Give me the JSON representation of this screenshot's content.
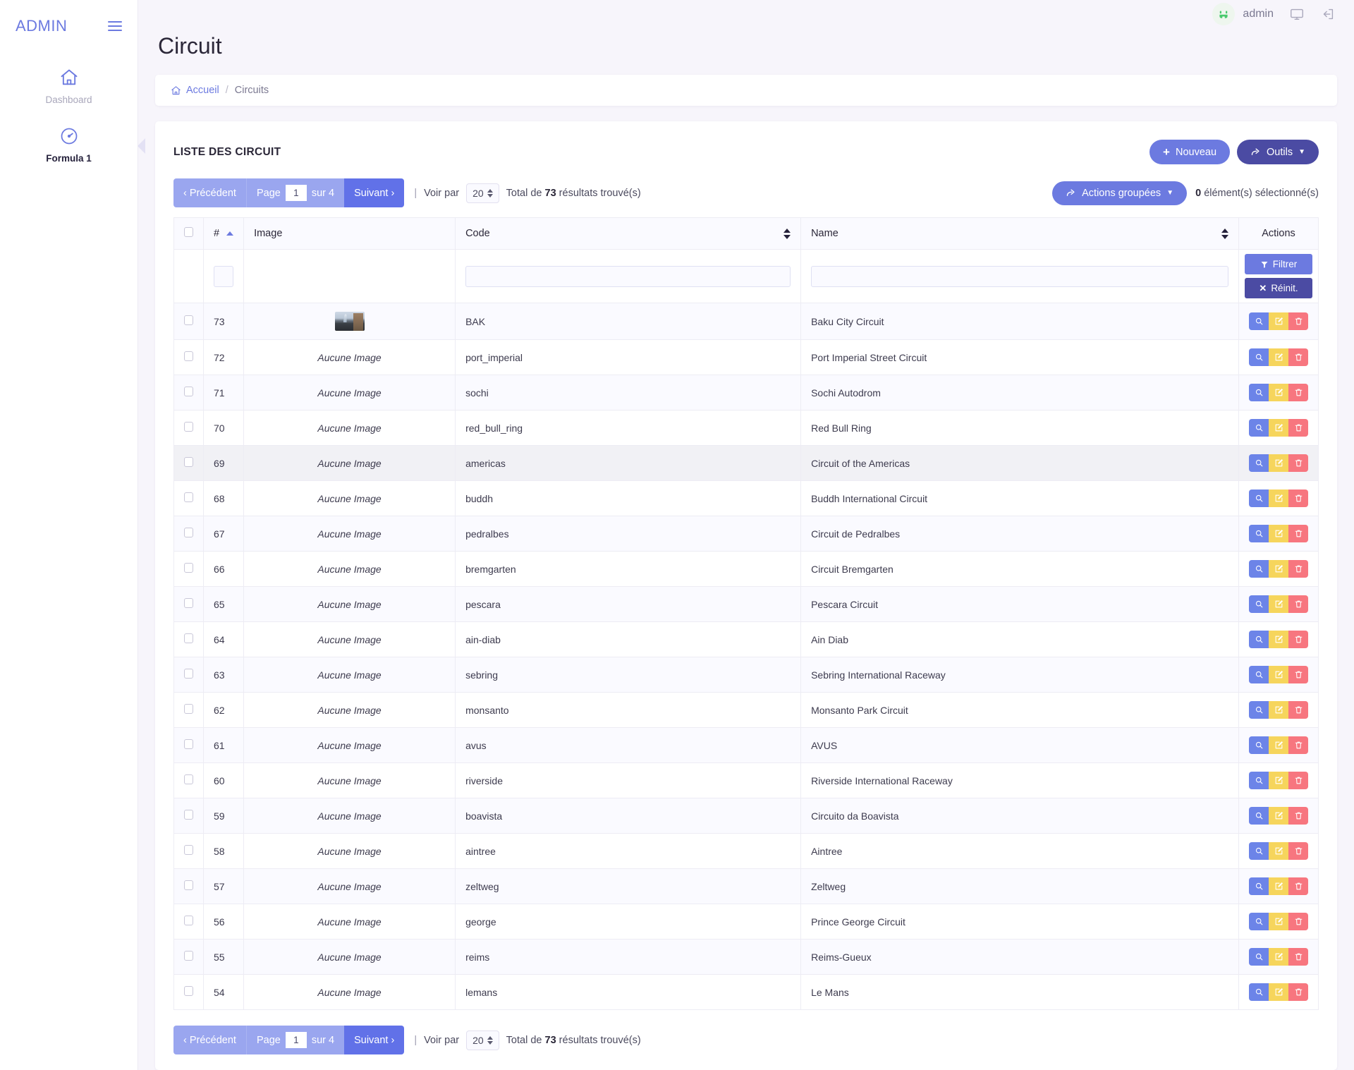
{
  "sidebar": {
    "brand": "ADMIN",
    "menu_icon": "hamburger-icon",
    "items": [
      {
        "label": "Dashboard",
        "icon": "home-icon",
        "active": false
      },
      {
        "label": "Formula 1",
        "icon": "gauge-icon",
        "active": true
      }
    ]
  },
  "topbar": {
    "user": "admin",
    "avatar_icon": "smiley-avatar-icon",
    "screen_icon": "monitor-icon",
    "logout_icon": "logout-icon"
  },
  "page": {
    "title": "Circuit"
  },
  "breadcrumb": {
    "home_icon": "home-icon",
    "home": "Accueil",
    "separator": "/",
    "current": "Circuits"
  },
  "list": {
    "title": "LISTE DES CIRCUIT",
    "new_label": "Nouveau",
    "tools_label": "Outils"
  },
  "pagination": {
    "prev": "‹ Précédent",
    "page_word": "Page",
    "page_value": "1",
    "of_word": "sur 4",
    "next": "Suivant ›",
    "divider": "|",
    "per_page_label": "Voir par",
    "per_page_value": "20",
    "total_prefix": "Total de",
    "total_count": "73",
    "total_suffix": "résultats trouvé(s)"
  },
  "bulk": {
    "label": "Actions groupées",
    "selected_count": "0",
    "selected_suffix": "élément(s) sélectionné(s)"
  },
  "table": {
    "columns": {
      "id": "#",
      "image": "Image",
      "code": "Code",
      "name": "Name",
      "actions": "Actions"
    },
    "filter": {
      "filtrer_label": "Filtrer",
      "reinit_label": "Réinit.",
      "filter_icon": "funnel-icon",
      "reset_icon": "close-icon"
    },
    "no_image_text": "Aucune Image",
    "row_actions": {
      "view_icon": "magnifier-icon",
      "edit_icon": "pencil-square-icon",
      "delete_icon": "trash-icon"
    },
    "rows": [
      {
        "id": "73",
        "image": "thumbnail",
        "code": "BAK",
        "name": "Baku City Circuit",
        "highlight": false
      },
      {
        "id": "72",
        "image": "none",
        "code": "port_imperial",
        "name": "Port Imperial Street Circuit",
        "highlight": false
      },
      {
        "id": "71",
        "image": "none",
        "code": "sochi",
        "name": "Sochi Autodrom",
        "highlight": false
      },
      {
        "id": "70",
        "image": "none",
        "code": "red_bull_ring",
        "name": "Red Bull Ring",
        "highlight": false
      },
      {
        "id": "69",
        "image": "none",
        "code": "americas",
        "name": "Circuit of the Americas",
        "highlight": true
      },
      {
        "id": "68",
        "image": "none",
        "code": "buddh",
        "name": "Buddh International Circuit",
        "highlight": false
      },
      {
        "id": "67",
        "image": "none",
        "code": "pedralbes",
        "name": "Circuit de Pedralbes",
        "highlight": false
      },
      {
        "id": "66",
        "image": "none",
        "code": "bremgarten",
        "name": "Circuit Bremgarten",
        "highlight": false
      },
      {
        "id": "65",
        "image": "none",
        "code": "pescara",
        "name": "Pescara Circuit",
        "highlight": false
      },
      {
        "id": "64",
        "image": "none",
        "code": "ain-diab",
        "name": "Ain Diab",
        "highlight": false
      },
      {
        "id": "63",
        "image": "none",
        "code": "sebring",
        "name": "Sebring International Raceway",
        "highlight": false
      },
      {
        "id": "62",
        "image": "none",
        "code": "monsanto",
        "name": "Monsanto Park Circuit",
        "highlight": false
      },
      {
        "id": "61",
        "image": "none",
        "code": "avus",
        "name": "AVUS",
        "highlight": false
      },
      {
        "id": "60",
        "image": "none",
        "code": "riverside",
        "name": "Riverside International Raceway",
        "highlight": false
      },
      {
        "id": "59",
        "image": "none",
        "code": "boavista",
        "name": "Circuito da Boavista",
        "highlight": false
      },
      {
        "id": "58",
        "image": "none",
        "code": "aintree",
        "name": "Aintree",
        "highlight": false
      },
      {
        "id": "57",
        "image": "none",
        "code": "zeltweg",
        "name": "Zeltweg",
        "highlight": false
      },
      {
        "id": "56",
        "image": "none",
        "code": "george",
        "name": "Prince George Circuit",
        "highlight": false
      },
      {
        "id": "55",
        "image": "none",
        "code": "reims",
        "name": "Reims-Gueux",
        "highlight": false
      },
      {
        "id": "54",
        "image": "none",
        "code": "lemans",
        "name": "Le Mans",
        "highlight": false
      }
    ]
  },
  "colors": {
    "accent": "#6c7ae0",
    "accent_dark": "#4b4ba3",
    "page_bg": "#f7f5fb",
    "view": "#6c84e8",
    "edit": "#f6d55c",
    "delete": "#f7767f"
  }
}
